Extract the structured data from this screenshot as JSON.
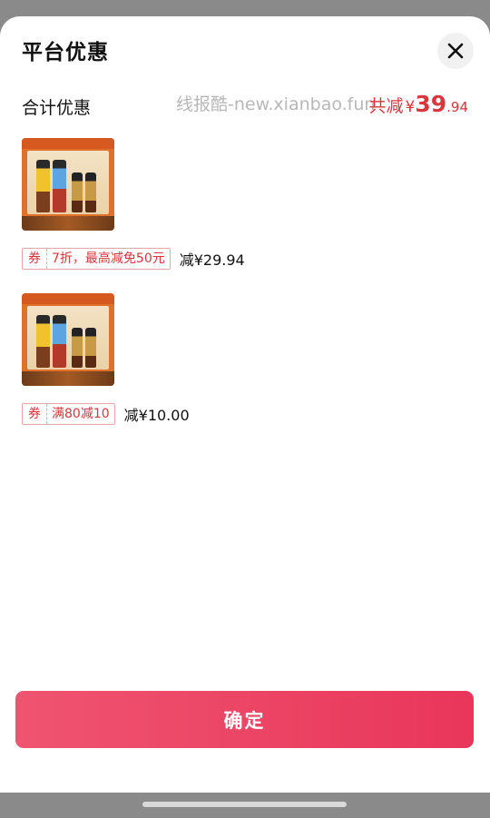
{
  "sheet": {
    "title": "平台优惠",
    "close_icon": "close-icon"
  },
  "summary": {
    "label": "合计优惠",
    "watermark": "线报酷-new.xianbao.fun",
    "total_label": "共减",
    "currency": "¥",
    "amount_int": "39",
    "amount_dec": ".94"
  },
  "items": [
    {
      "coupon_tag": "券",
      "coupon_text": "7折，最高减免50元",
      "reduction": "减¥29.94"
    },
    {
      "coupon_tag": "券",
      "coupon_text": "满80减10",
      "reduction": "减¥10.00"
    }
  ],
  "confirm_button": {
    "label": "确定"
  },
  "colors": {
    "accent": "#d9363e",
    "button_start": "#ef5470",
    "button_end": "#e9365a"
  }
}
